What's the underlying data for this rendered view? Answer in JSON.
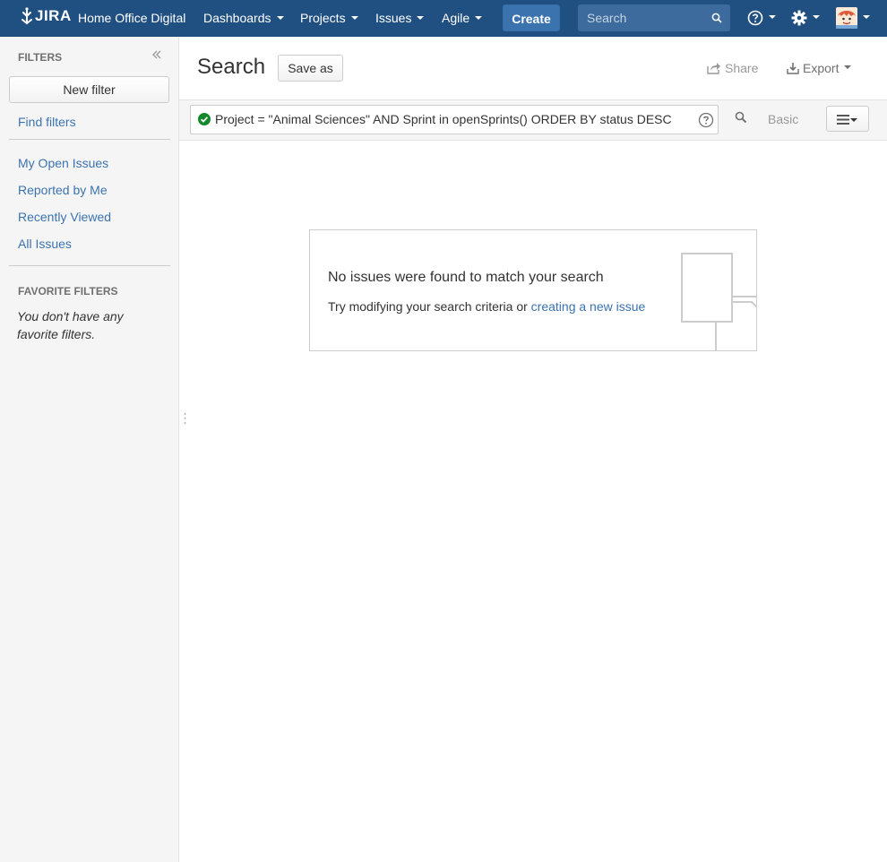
{
  "header": {
    "logo_text": "JIRA",
    "instance": "Home Office Digital",
    "nav": [
      {
        "label": "Dashboards"
      },
      {
        "label": "Projects"
      },
      {
        "label": "Issues"
      },
      {
        "label": "Agile"
      }
    ],
    "create_label": "Create",
    "search_placeholder": "Search",
    "accent_color": "#205081"
  },
  "sidebar": {
    "filters_heading": "FILTERS",
    "new_filter_label": "New filter",
    "find_filters_label": "Find filters",
    "items": [
      {
        "label": "My Open Issues"
      },
      {
        "label": "Reported by Me"
      },
      {
        "label": "Recently Viewed"
      },
      {
        "label": "All Issues"
      }
    ],
    "favorites_heading": "FAVORITE FILTERS",
    "favorites_empty": "You don't have any favorite filters."
  },
  "main": {
    "title": "Search",
    "save_as_label": "Save as",
    "share_label": "Share",
    "export_label": "Export",
    "jql_query": "Project = \"Animal Sciences\" AND Sprint in openSprints() ORDER BY status DESC",
    "basic_label": "Basic",
    "empty_title": "No issues were found to match your search",
    "empty_text": "Try modifying your search criteria or ",
    "empty_link": "creating a new issue"
  }
}
